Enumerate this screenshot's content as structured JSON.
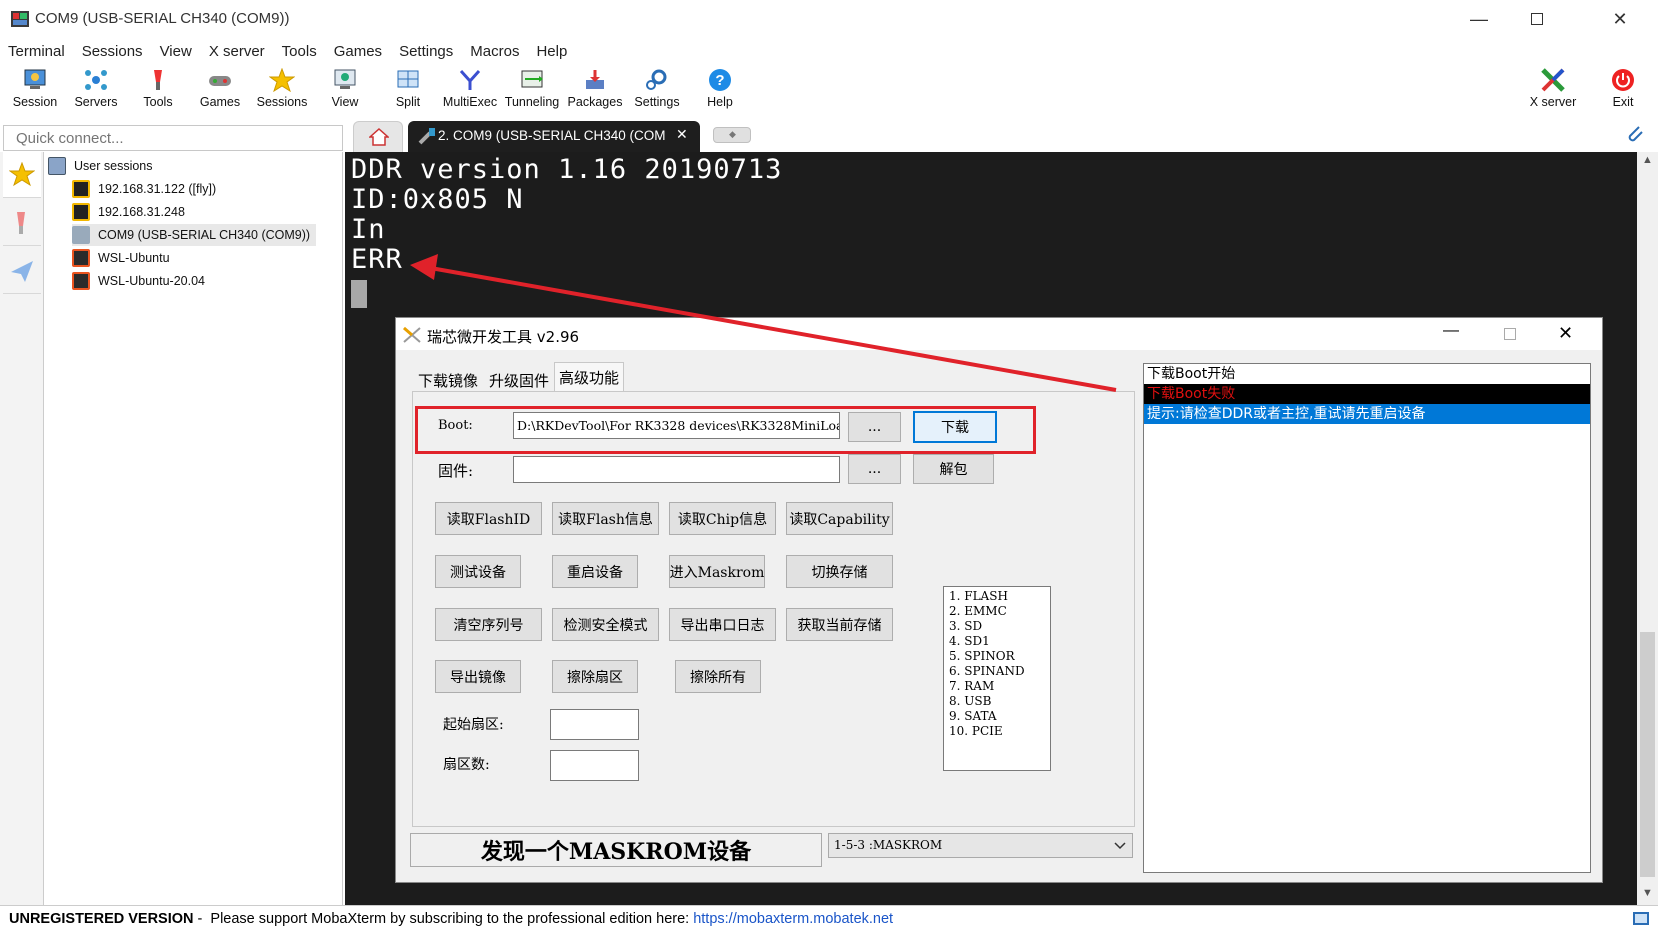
{
  "window": {
    "title": "COM9  (USB-SERIAL CH340 (COM9))"
  },
  "menu": [
    "Terminal",
    "Sessions",
    "View",
    "X server",
    "Tools",
    "Games",
    "Settings",
    "Macros",
    "Help"
  ],
  "toolbar": {
    "left": [
      {
        "label": "Session",
        "icon": "session-icon"
      },
      {
        "label": "Servers",
        "icon": "servers-icon"
      },
      {
        "label": "Tools",
        "icon": "tools-icon"
      },
      {
        "label": "Games",
        "icon": "games-icon"
      },
      {
        "label": "Sessions",
        "icon": "star-icon"
      },
      {
        "label": "View",
        "icon": "view-icon"
      },
      {
        "label": "Split",
        "icon": "split-icon"
      },
      {
        "label": "MultiExec",
        "icon": "multiexec-icon"
      },
      {
        "label": "Tunneling",
        "icon": "tunneling-icon"
      },
      {
        "label": "Packages",
        "icon": "packages-icon"
      },
      {
        "label": "Settings",
        "icon": "settings-icon"
      },
      {
        "label": "Help",
        "icon": "help-icon"
      }
    ],
    "xserver": "X server",
    "exit": "Exit"
  },
  "quick_connect": {
    "placeholder": "Quick connect..."
  },
  "tabs": {
    "active": "2. COM9  (USB-SERIAL CH340 (COM"
  },
  "sessions": {
    "root": "User sessions",
    "items": [
      {
        "label": "192.168.31.122 ([fly])",
        "icon": "ssh-icon"
      },
      {
        "label": "192.168.31.248",
        "icon": "ssh-icon"
      },
      {
        "label": "COM9  (USB-SERIAL CH340 (COM9))",
        "icon": "serial-icon"
      },
      {
        "label": "WSL-Ubuntu",
        "icon": "ubuntu-icon"
      },
      {
        "label": "WSL-Ubuntu-20.04",
        "icon": "ubuntu-icon"
      }
    ]
  },
  "terminal": {
    "lines": [
      "DDR version 1.16 20190713",
      "ID:0x805 N",
      "In",
      "ERR"
    ]
  },
  "status": {
    "unregistered": "UNREGISTERED VERSION",
    "message": " -  Please support MobaXterm by subscribing to the professional edition here: ",
    "link": "https://mobaxterm.mobatek.net"
  },
  "dialog": {
    "title": "瑞芯微开发工具 v2.96",
    "tabs": [
      "下载镜像",
      "升级固件",
      "高级功能"
    ],
    "boot_label": "Boot:",
    "boot_path": "D:\\RKDevTool\\For RK3328 devices\\RK3328MiniLoa",
    "browse": "...",
    "download": "下载",
    "firmware_label": "固件:",
    "unpack": "解包",
    "buttons": [
      [
        "读取FlashID",
        "读取Flash信息",
        "读取Chip信息",
        "读取Capability"
      ],
      [
        "测试设备",
        "重启设备",
        "进入Maskrom",
        "切换存储"
      ],
      [
        "清空序列号",
        "检测安全模式",
        "导出串口日志",
        "获取当前存储"
      ],
      [
        "导出镜像",
        "擦除扇区",
        "擦除所有"
      ]
    ],
    "start_sector_label": "起始扇区:",
    "sector_count_label": "扇区数:",
    "storage_list": [
      "1.  FLASH",
      "2.  EMMC",
      "3.  SD",
      "4.  SD1",
      "5.  SPINOR",
      "6.  SPINAND",
      "7.  RAM",
      "8.  USB",
      "9.  SATA",
      "10.  PCIE"
    ],
    "log": [
      {
        "text": "下载Boot开始",
        "style": "normal"
      },
      {
        "text": "下载Boot失败",
        "style": "error"
      },
      {
        "text": "提示:请检查DDR或者主控,重试请先重启设备",
        "style": "selected"
      }
    ],
    "device_status": "发现一个MASKROM设备",
    "device_select": "1-5-3  :MASKROM"
  },
  "colors": {
    "accent": "#0078d7",
    "annotation": "#e0222a",
    "terminal_bg": "#1c1c1c"
  }
}
